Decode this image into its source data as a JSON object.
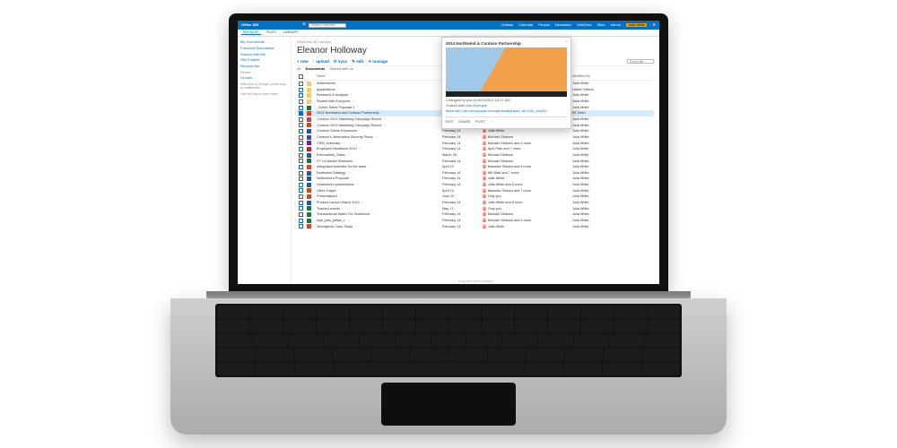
{
  "suite": {
    "brand": "Office 365",
    "links": [
      "Outlook",
      "Calendar",
      "People",
      "Newsfeed",
      "OneDrive",
      "Sites",
      "Admin"
    ],
    "user": "Julia White",
    "gear": "Settings"
  },
  "ribbon": {
    "tabs": [
      "BROWSE",
      "FILES",
      "LIBRARY"
    ],
    "active": 0
  },
  "search": {
    "placeholder": "Search OneDrive"
  },
  "nav": {
    "items": [
      "My Documents",
      "Followed Documents",
      "Shared with Me",
      "Site Folders",
      "Recycle Bin"
    ],
    "recent_hdr": "Recent",
    "recent": [
      "Groups"
    ],
    "promo": "Welcome to Groups, a new way to collaborate.",
    "promo2": "Use this link to learn more."
  },
  "page": {
    "breadcrumb": "OneDrive @ Contoso",
    "title": "Eleanor Holloway"
  },
  "toolbar": {
    "new": "+ new",
    "upload": "↑ upload",
    "sync": "⟳ sync",
    "edit": "✎ edit",
    "manage": "✦ manage",
    "find_placeholder": "Find a file"
  },
  "view_tabs": {
    "items": [
      "All",
      "Documents",
      "Shared with us"
    ],
    "active": 1
  },
  "columns": [
    "",
    "",
    "Name",
    "Modified",
    "Sharing",
    "Modified By"
  ],
  "preview": {
    "title": "2014 Northwind & Contoso Partnership",
    "changed": "Changed by you on 6/23/2013 10:47 AM",
    "shared_label": "Shared with",
    "shared_with": "lots of people",
    "url": "https://a0-14m-my.spoppe.com/personal/juliaw_a0-14m_ccs/Do",
    "actions": [
      "EDIT",
      "SHARE",
      "POST",
      "···"
    ]
  },
  "files": [
    {
      "icon": "folder",
      "name": "Attachments",
      "modified": "",
      "sharing": "",
      "by": "Julia White"
    },
    {
      "icon": "folder",
      "name": "Applications",
      "modified": "",
      "sharing": "",
      "by": "Leilani Gibson"
    },
    {
      "icon": "folder",
      "name": "Research & Analysis",
      "modified": "",
      "sharing": "",
      "by": "Julia White"
    },
    {
      "icon": "folder",
      "name": "Shared with Everyone",
      "modified": "",
      "sharing": "",
      "by": "Julia White"
    },
    {
      "icon": "xls",
      "name": "_Green Sales Proposal 2",
      "modified": "February 14",
      "sharing": "Julia White",
      "by": "Julia White"
    },
    {
      "icon": "ppt",
      "name": "2014 Northwind and Contoso Partnership",
      "modified": "February 14",
      "sharing": "CONTOSO\\DannyTeamLE and 10 more",
      "by": "RT Kesh",
      "selected": true
    },
    {
      "icon": "ppt",
      "name": "Contoso 2014 Marketing Campaign Report",
      "modified": "March 6",
      "sharing": "Michael Gibbons and 3 more",
      "by": "Julia White"
    },
    {
      "icon": "ppt",
      "name": "Contoso 2014 Marketing Campaign Report",
      "modified": "February 14",
      "sharing": "Michael Gibbons",
      "by": "Julia White"
    },
    {
      "icon": "doc",
      "name": "Contoso Online Expansion",
      "modified": "February 14",
      "sharing": "Julia White",
      "by": "Julia White"
    },
    {
      "icon": "doc",
      "name": "Contoso's Information Security Policy",
      "modified": "February 14",
      "sharing": "Michael Gibbons",
      "by": "Julia White"
    },
    {
      "icon": "one",
      "name": "CRM_externals",
      "modified": "February 14",
      "sharing": "Michael Gibbons and 4 more",
      "by": "Julia White"
    },
    {
      "icon": "pdf",
      "name": "Employee Handbook 2014",
      "modified": "February 14",
      "sharing": "April Park and 7 more",
      "by": "Julia White"
    },
    {
      "icon": "doc",
      "name": "Externalinfo_Sales",
      "modified": "March 28",
      "sharing": "Michael Gibbons",
      "by": "Julia White"
    },
    {
      "icon": "xls",
      "name": "FY 14 Market Research",
      "modified": "February 14",
      "sharing": "Michael Gibbons",
      "by": "Julia White"
    },
    {
      "icon": "ppt",
      "name": "Integration Activities for the team",
      "modified": "April 10",
      "sharing": "Manuela Silveira and 4 more",
      "by": "Julia White"
    },
    {
      "icon": "doc",
      "name": "Northwind Strategy",
      "modified": "February 14",
      "sharing": "MK Bath and 7 more",
      "by": "Julia White"
    },
    {
      "icon": "doc",
      "name": "Northwind's Proposal",
      "modified": "February 14",
      "sharing": "Julia White",
      "by": "Julia White"
    },
    {
      "icon": "doc",
      "name": "Northwind's presentation",
      "modified": "February 14",
      "sharing": "Julia White and 6 more",
      "by": "Julia White"
    },
    {
      "icon": "ppt",
      "name": "Office Graph",
      "modified": "April 10",
      "sharing": "Manuela Silveira and 7 more",
      "by": "Julia White"
    },
    {
      "icon": "ppt",
      "name": "Presentation1",
      "modified": "June 20",
      "sharing": "Only you",
      "by": "Julia White"
    },
    {
      "icon": "doc",
      "name": "Product Launch March 2014",
      "modified": "February 14",
      "sharing": "Julia White and 5 more",
      "by": "Julia White"
    },
    {
      "icon": "xls",
      "name": "Tracked-events",
      "modified": "May 17",
      "sharing": "Only you",
      "by": "Julia White"
    },
    {
      "icon": "xls",
      "name": "Transactional Matrix For Northwind",
      "modified": "February 14",
      "sharing": "Michael Gibbons",
      "by": "Julia White"
    },
    {
      "icon": "xls",
      "name": "wpb_jobs_juliaw_c",
      "modified": "February 14",
      "sharing": "Michael Gibbons and 4 more",
      "by": "Julia White"
    },
    {
      "icon": "ppt",
      "name": "Woodgrove Case Study",
      "modified": "February 14",
      "sharing": "Julia White",
      "by": "Julia White"
    }
  ],
  "drag_hint": "Drag files here to upload"
}
